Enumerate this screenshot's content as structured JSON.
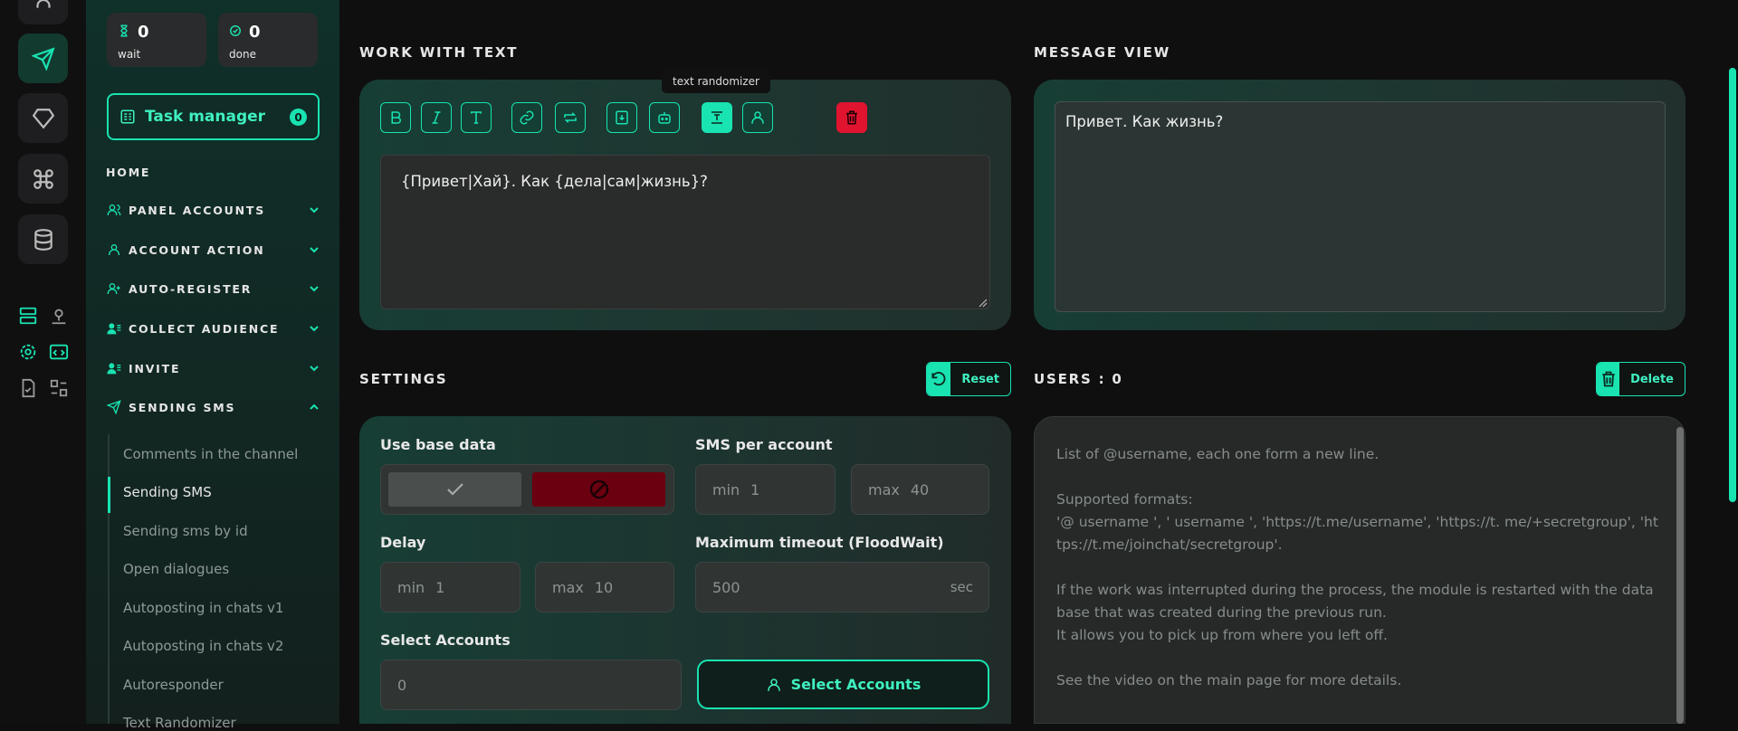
{
  "sidebar": {
    "stats": [
      {
        "value": "0",
        "label": "wait"
      },
      {
        "value": "0",
        "label": "done"
      }
    ],
    "task_manager": {
      "label": "Task manager",
      "count": "0"
    },
    "home": "HOME",
    "sections": [
      "PANEL ACCOUNTS",
      "ACCOUNT ACTION",
      "AUTO-REGISTER",
      "COLLECT AUDIENCE",
      "INVITE",
      "SENDING SMS"
    ],
    "sub_items": [
      "Comments in the channel",
      "Sending SMS",
      "Sending sms by id",
      "Open dialogues",
      "Autoposting in chats v1",
      "Autoposting in chats v2",
      "Autoresponder",
      "Text Randomizer"
    ]
  },
  "work_with_text": {
    "title": "WORK WITH TEXT",
    "tooltip": "text randomizer",
    "toolbar_icons": [
      "bold-icon",
      "italic-icon",
      "text-icon",
      "link-icon",
      "repeat-icon",
      "download-icon",
      "bot-icon",
      "randomizer-icon",
      "user-icon",
      "trash-icon"
    ],
    "text": "{Привет|Хай}. Как {дела|сам|жизнь}?"
  },
  "message_view": {
    "title": "MESSAGE VIEW",
    "text": "Привет. Как жизнь?"
  },
  "settings": {
    "title": "SETTINGS",
    "reset_label": "Reset",
    "use_base_data": "Use base data",
    "sms_per_account": "SMS per account",
    "sms_min": {
      "label": "min",
      "value": "1"
    },
    "sms_max": {
      "label": "max",
      "value": "40"
    },
    "delay": "Delay",
    "delay_min": {
      "label": "min",
      "value": "1"
    },
    "delay_max": {
      "label": "max",
      "value": "10"
    },
    "max_timeout": "Maximum timeout (FloodWait)",
    "timeout": {
      "value": "500",
      "unit": "sec"
    },
    "select_accounts": "Select Accounts",
    "accounts_value": "0",
    "select_accounts_button": "Select Accounts"
  },
  "users": {
    "title": "USERS : 0",
    "delete_label": "Delete",
    "placeholder_lines": [
      "List of @username, each one form a new line.",
      "",
      "Supported formats:",
      "'@ username ', ' username ', 'https://t.me/username', 'https://t. me/+secretgroup', 'https://t.me/joinchat/secretgroup'.",
      "",
      "If the work was interrupted during the process, the module is restarted with the database that was created during the previous run.",
      "It allows you to pick up from where you left off.",
      "",
      "See the video on the main page for more details."
    ]
  },
  "colors": {
    "accent": "#19e3b1",
    "danger": "#e0142f",
    "bg": "#0f0f10"
  }
}
